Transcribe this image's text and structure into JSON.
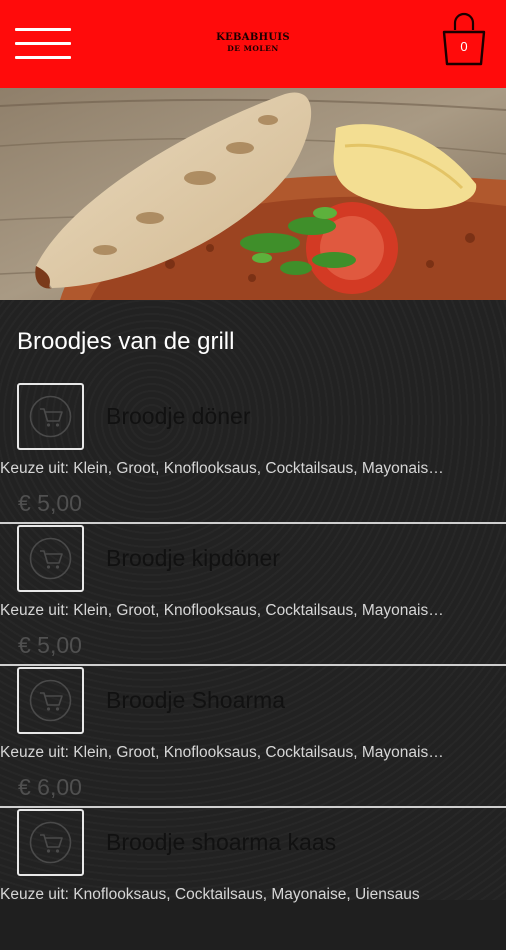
{
  "header": {
    "logo_line1": "KEBABHUIS",
    "logo_line2": "DE MOLEN",
    "cart_count": "0"
  },
  "category": {
    "title": "Broodjes van de grill"
  },
  "products": [
    {
      "name": "Broodje döner",
      "description": "Keuze uit: Klein, Groot, Knoflooksaus, Cocktailsaus, Mayonaise, Uiensaus",
      "price": "€ 5,00"
    },
    {
      "name": "Broodje kipdöner",
      "description": "Keuze uit: Klein, Groot, Knoflooksaus, Cocktailsaus, Mayonaise, Uiensaus",
      "price": "€ 5,00"
    },
    {
      "name": "Broodje Shoarma",
      "description": "Keuze uit: Klein, Groot, Knoflooksaus, Cocktailsaus, Mayonaise, Uiensaus",
      "price": "€ 6,00"
    },
    {
      "name": "Broodje shoarma kaas",
      "description": "Keuze uit: Knoflooksaus, Cocktailsaus, Mayonaise, Uiensaus",
      "price": ""
    }
  ],
  "icons": {
    "menu": "hamburger-menu-icon",
    "cart": "shopping-bag-icon",
    "add_to_cart": "add-to-cart-icon"
  },
  "colors": {
    "header_bg": "#ff0b0b",
    "content_bg": "#222222",
    "divider": "#cfcfcf"
  }
}
